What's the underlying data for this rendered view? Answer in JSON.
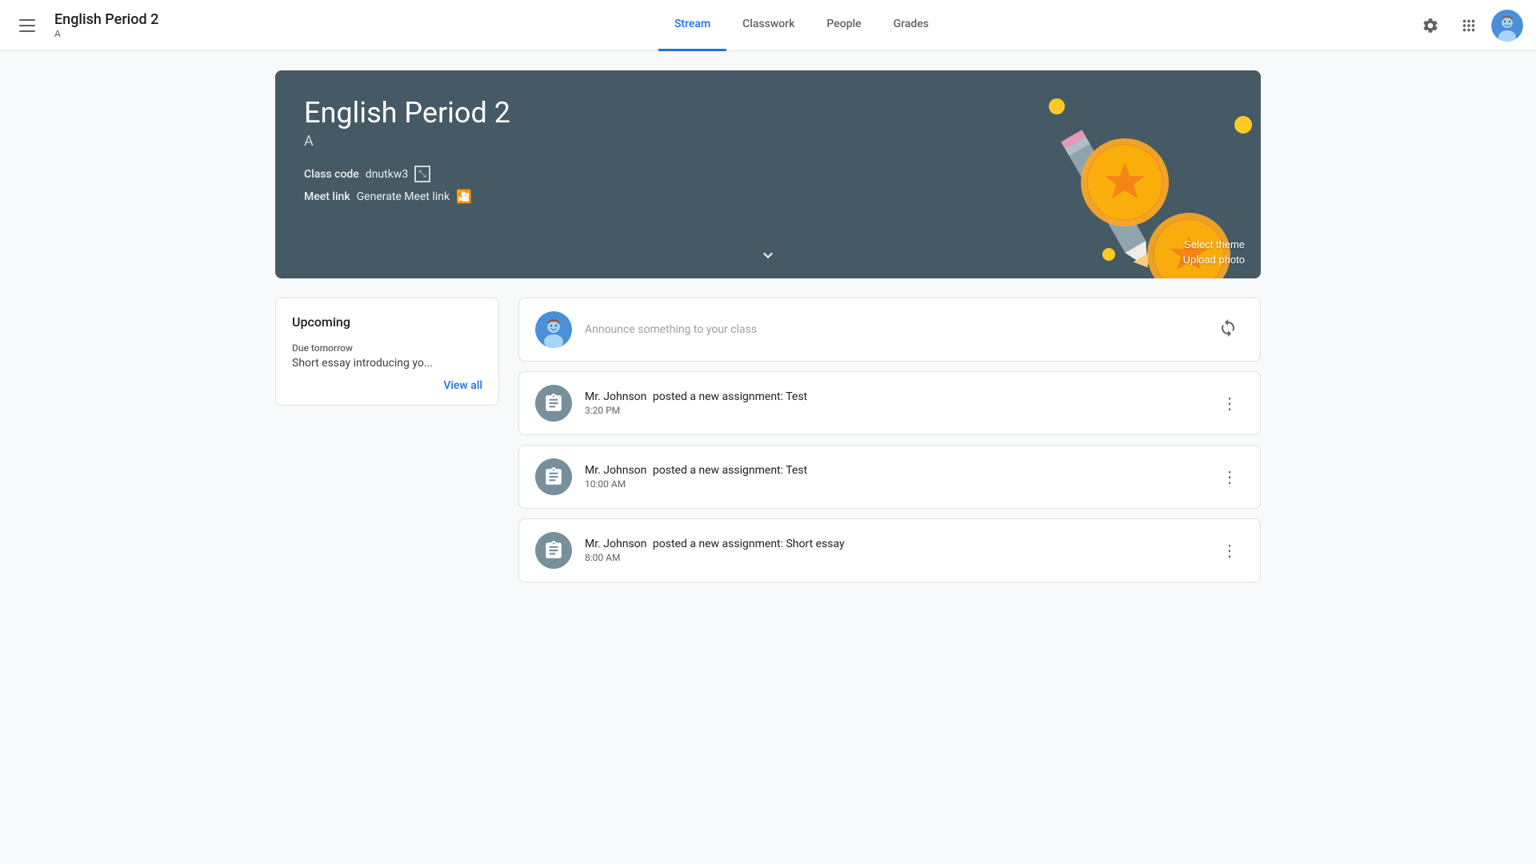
{
  "header": {
    "menu_label": "Menu",
    "title": "English Period 2",
    "subtitle": "A",
    "nav": [
      {
        "id": "stream",
        "label": "Stream",
        "active": true
      },
      {
        "id": "classwork",
        "label": "Classwork",
        "active": false
      },
      {
        "id": "people",
        "label": "People",
        "active": false
      },
      {
        "id": "grades",
        "label": "Grades",
        "active": false
      }
    ],
    "settings_label": "Settings",
    "apps_label": "Google apps"
  },
  "hero": {
    "title": "English Period 2",
    "subtitle": "A",
    "class_code_label": "Class code",
    "class_code_value": "dnutkw3",
    "meet_link_label": "Meet link",
    "generate_meet_label": "Generate Meet link",
    "select_theme_label": "Select theme",
    "upload_photo_label": "Upload photo"
  },
  "upcoming": {
    "title": "Upcoming",
    "due_label": "Due tomorrow",
    "due_item": "Short essay introducing yo...",
    "view_all_label": "View all"
  },
  "stream": {
    "announce_placeholder": "Announce something to your class",
    "posts": [
      {
        "id": "post1",
        "author": "Mr. Johnson",
        "action": "posted a new assignment: Test",
        "time": "3:20 PM"
      },
      {
        "id": "post2",
        "author": "Mr. Johnson",
        "action": "posted a new assignment: Test",
        "time": "10:00 AM"
      },
      {
        "id": "post3",
        "author": "Mr. Johnson",
        "action": "posted a new assignment: Short essay",
        "time": "8:00 AM"
      }
    ]
  }
}
